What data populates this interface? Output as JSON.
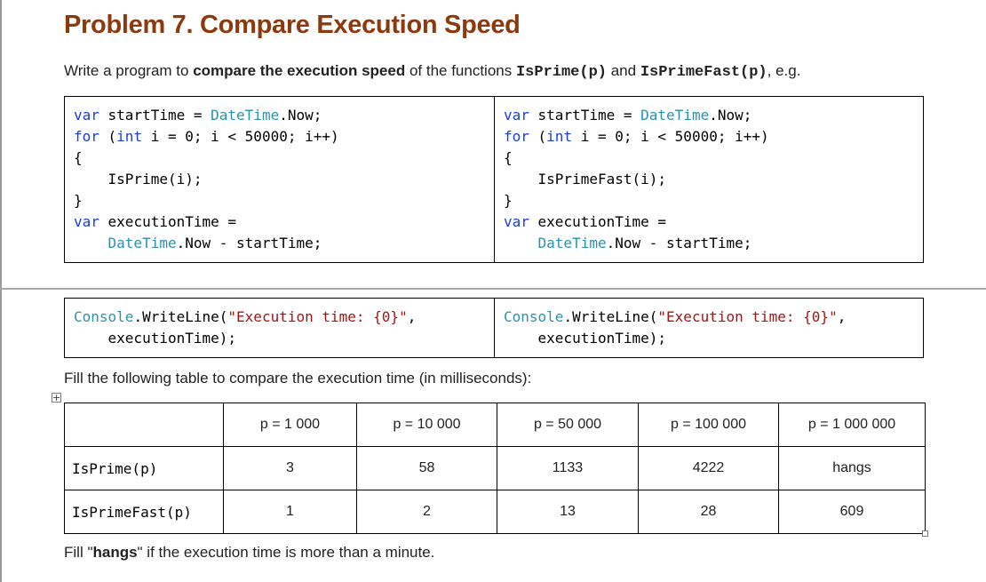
{
  "title": "Problem 7.  Compare Execution Speed",
  "intro": {
    "prefix": "Write a program to ",
    "bold": "compare the execution speed",
    "middle": " of the functions ",
    "func1": "IsPrime(p)",
    "and": " and ",
    "func2": "IsPrimeFast(p)",
    "suffix": ", e.g."
  },
  "code_left": {
    "func_call": "IsPrime(i);"
  },
  "code_right": {
    "func_call": "IsPrimeFast(i);"
  },
  "fill_instruction": "Fill the following table to compare the execution time (in milliseconds):",
  "table": {
    "headers": [
      "",
      "p = 1 000",
      "p = 10 000",
      "p = 50 000",
      "p = 100 000",
      "p = 1 000 000"
    ],
    "rows": [
      {
        "label": "IsPrime(p)",
        "values": [
          "3",
          "58",
          "1133",
          "4222",
          "hangs"
        ]
      },
      {
        "label": "IsPrimeFast(p)",
        "values": [
          "1",
          "2",
          "13",
          "28",
          "609"
        ]
      }
    ]
  },
  "footer": {
    "prefix": "Fill \"",
    "bold": "hangs",
    "suffix": "\" if the execution time is more than a minute."
  },
  "table_handle_glyph": "+"
}
